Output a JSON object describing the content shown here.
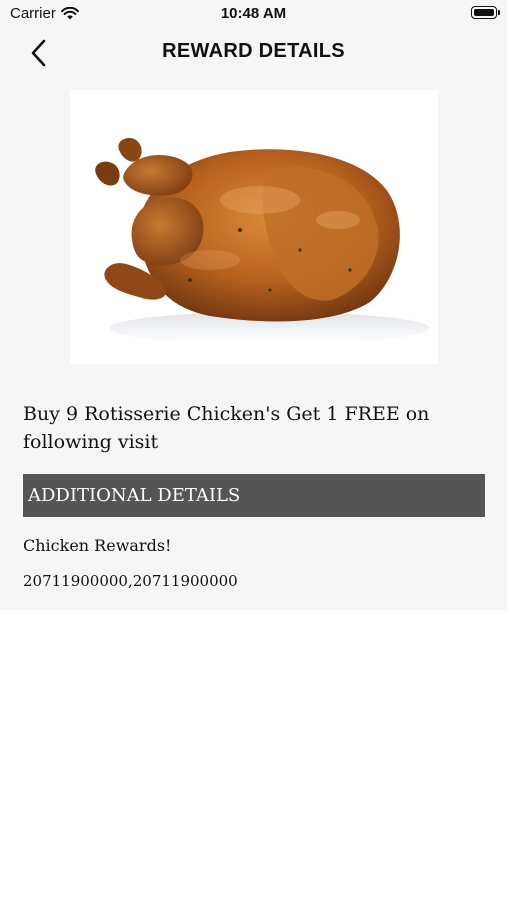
{
  "status_bar": {
    "carrier": "Carrier",
    "time": "10:48 AM",
    "battery_level": 1.0
  },
  "nav": {
    "title": "REWARD DETAILS",
    "back_icon": "chevron-left-icon"
  },
  "reward": {
    "image_alt": "rotisserie chicken",
    "title": "Buy 9 Rotisserie Chicken's Get 1 FREE on following visit"
  },
  "additional": {
    "header": "ADDITIONAL DETAILS",
    "name": "Chicken Rewards!",
    "codes": "20711900000,20711900000"
  },
  "colors": {
    "header_bg": "#555555",
    "top_bg": "#f6f6f6"
  }
}
